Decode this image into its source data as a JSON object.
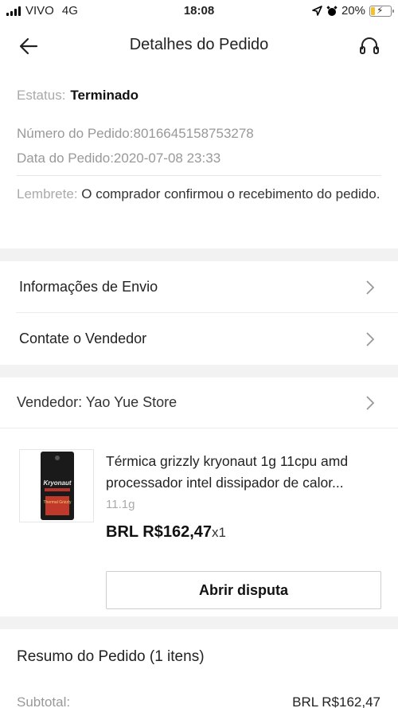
{
  "statusbar": {
    "carrier": "VIVO",
    "network": "4G",
    "time": "18:08",
    "battery": "20%",
    "battery_level": 0.2
  },
  "nav": {
    "title": "Detalhes do Pedido"
  },
  "order": {
    "status_label": "Estatus:",
    "status_value": "Terminado",
    "number_label": "Número do Pedido:",
    "number_value": "8016645158753278",
    "date_label": "Data do Pedido:",
    "date_value": "2020-07-08 23:33",
    "reminder_label": "Lembrete:",
    "reminder_value": " O comprador confirmou o recebimento do pedido."
  },
  "links": {
    "shipping": "Informações de Envio",
    "contact": "Contate o Vendedor"
  },
  "seller": {
    "label": "Vendedor: Yao Yue Store"
  },
  "product": {
    "title": "Térmica grizzly kryonaut 1g 11cpu amd processador intel dissipador de calor...",
    "variant": "11.1g",
    "price": "BRL R$162,47",
    "qty": "x1",
    "image_text_1": "Kryonaut",
    "image_text_2": "Thermal Grizzly",
    "dispute_button": "Abrir disputa"
  },
  "summary": {
    "title": "Resumo do Pedido (1 itens)",
    "subtotal_label": "Subtotal:",
    "subtotal_value": "BRL R$162,47"
  },
  "colors": {
    "background": "#f2f2f2",
    "card": "#ffffff",
    "battery": "#f2c12e"
  }
}
